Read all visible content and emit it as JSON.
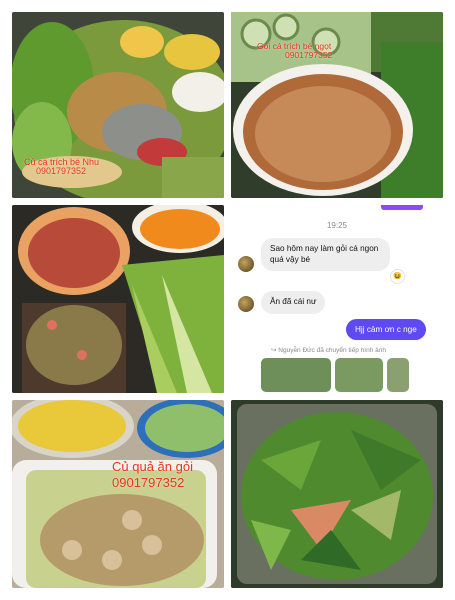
{
  "tiles": {
    "t1": {
      "watermark_line1": "Củ cá trích bé Nhu",
      "watermark_line2": "0901797352"
    },
    "t2": {
      "watermark_line1": "Gỏi cá trích bé ngọt",
      "watermark_line2": "0901797352"
    },
    "t5": {
      "watermark_line1": "Củ quả ăn gỏi",
      "watermark_line2": "0901797352"
    }
  },
  "chat": {
    "timestamp": "19:25",
    "messages": [
      {
        "text": "Sao hôm nay làm gỏi cá ngon quá vậy bé",
        "reaction": "😆"
      },
      {
        "text": "Ăn đã cái nư"
      },
      {
        "text": "Hjj cảm ơn c nge"
      }
    ],
    "forward_note": "Nguyễn Đức đã chuyển tiếp hình ảnh"
  },
  "colors": {
    "watermark": "#e8351f",
    "sent_bubble": "#5f49f2",
    "received_bubble": "#eeeeee",
    "accent_bar": "#8a4cf0"
  },
  "icons": [
    "avatar",
    "forward-icon",
    "emoji-reaction"
  ]
}
